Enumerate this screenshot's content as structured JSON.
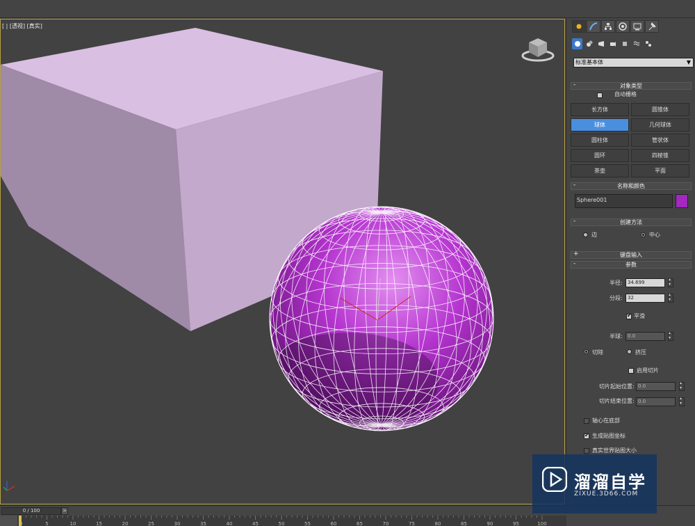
{
  "viewport": {
    "label": "[ | [透视] [真实]"
  },
  "panel": {
    "tabs": [
      "create-icon",
      "modify-icon",
      "hierarchy-icon",
      "motion-icon",
      "display-icon",
      "utilities-icon"
    ],
    "subtabs": [
      "geometry-icon",
      "shapes-icon",
      "lights-icon",
      "cameras-icon",
      "helpers-icon",
      "spacewarps-icon",
      "systems-icon"
    ],
    "category": "标准基本体",
    "object_type": {
      "title": "对象类型",
      "autogrid_label": "自动栅格",
      "buttons": [
        "长方体",
        "圆锥体",
        "球体",
        "几何球体",
        "圆柱体",
        "管状体",
        "圆环",
        "四棱锥",
        "茶壶",
        "平面"
      ],
      "active": "球体"
    },
    "name_color": {
      "title": "名称和颜色",
      "name": "Sphere001",
      "color": "#a228c0"
    },
    "creation_method": {
      "title": "创建方法",
      "edge_label": "边",
      "center_label": "中心"
    },
    "keyboard_entry": {
      "title": "键盘输入"
    },
    "parameters": {
      "title": "参数",
      "radius_label": "半径:",
      "radius_value": "34.699",
      "segments_label": "分段:",
      "segments_value": "32",
      "smooth_label": "平滑",
      "hemisphere_label": "半球:",
      "hemisphere_value": "0.0",
      "chop_label": "切除",
      "squash_label": "挤压",
      "slice_on_label": "启用切片",
      "slice_from_label": "切片起始位置:",
      "slice_from_value": "0.0",
      "slice_to_label": "切片结束位置:",
      "slice_to_value": "0.0",
      "base_to_pivot_label": "轴心在底部",
      "gen_mapping_label": "生成贴图坐标",
      "real_world_label": "真实世界贴图大小"
    }
  },
  "timeline": {
    "slider_text": "0 / 100",
    "next_label": ">",
    "ticks": [
      0,
      5,
      10,
      15,
      20,
      25,
      30,
      35,
      40,
      45,
      50,
      55,
      60,
      65,
      70,
      75,
      80,
      85,
      90,
      95,
      100
    ]
  },
  "watermark": {
    "title": "溜溜自学",
    "url": "ZIXUE.3D66.COM"
  },
  "colors": {
    "box": "#d8b8e0",
    "sphere": "#a228c0",
    "active_button": "#4a8ee0"
  }
}
